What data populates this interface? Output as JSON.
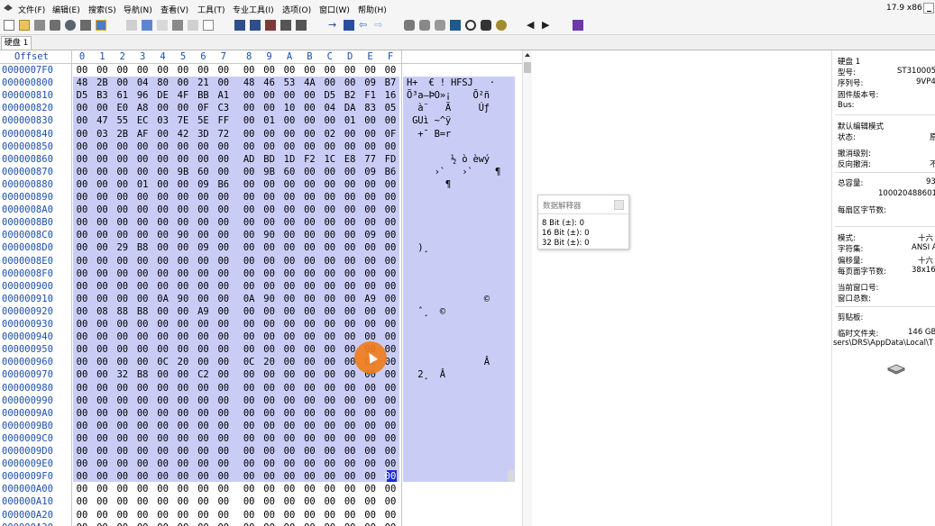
{
  "menubar": {
    "items": [
      "文件(F)",
      "编辑(E)",
      "搜索(S)",
      "导航(N)",
      "查看(V)",
      "工具(T)",
      "专业工具(I)",
      "选项(O)",
      "窗口(W)",
      "帮助(H)"
    ],
    "version": "17.9 x86"
  },
  "tabs": [
    "硬盘 1"
  ],
  "hex": {
    "offset_label": "Offset",
    "columns": [
      "0",
      "1",
      "2",
      "3",
      "4",
      "5",
      "6",
      "7",
      "8",
      "9",
      "A",
      "B",
      "C",
      "D",
      "E",
      "F"
    ],
    "rows": [
      {
        "offset": "0000007F0",
        "bytes": [
          "00",
          "00",
          "00",
          "00",
          "00",
          "00",
          "00",
          "00",
          "00",
          "00",
          "00",
          "00",
          "00",
          "00",
          "00",
          "00"
        ],
        "ascii": ""
      },
      {
        "offset": "000000800",
        "bytes": [
          "48",
          "2B",
          "00",
          "04",
          "80",
          "00",
          "21",
          "00",
          "48",
          "46",
          "53",
          "4A",
          "00",
          "00",
          "09",
          "B7"
        ],
        "ascii": "H+  € ! HFSJ   ·"
      },
      {
        "offset": "000000810",
        "bytes": [
          "D5",
          "B3",
          "61",
          "96",
          "DE",
          "4F",
          "BB",
          "A1",
          "00",
          "00",
          "00",
          "00",
          "D5",
          "B2",
          "F1",
          "16"
        ],
        "ascii": "Õ³a–ÞO»¡    Õ²ñ"
      },
      {
        "offset": "000000820",
        "bytes": [
          "00",
          "00",
          "E0",
          "A8",
          "00",
          "00",
          "0F",
          "C3",
          "00",
          "00",
          "10",
          "00",
          "04",
          "DA",
          "83",
          "05"
        ],
        "ascii": "  à¨   Ã     Úƒ"
      },
      {
        "offset": "000000830",
        "bytes": [
          "00",
          "47",
          "55",
          "EC",
          "03",
          "7E",
          "5E",
          "FF",
          "00",
          "01",
          "00",
          "00",
          "00",
          "01",
          "00",
          "00"
        ],
        "ascii": " GUì ~^ÿ"
      },
      {
        "offset": "000000840",
        "bytes": [
          "00",
          "03",
          "2B",
          "AF",
          "00",
          "42",
          "3D",
          "72",
          "00",
          "00",
          "00",
          "00",
          "02",
          "00",
          "00",
          "0F"
        ],
        "ascii": "  +¯ B=r"
      },
      {
        "offset": "000000850",
        "bytes": [
          "00",
          "00",
          "00",
          "00",
          "00",
          "00",
          "00",
          "00",
          "00",
          "00",
          "00",
          "00",
          "00",
          "00",
          "00",
          "00"
        ],
        "ascii": ""
      },
      {
        "offset": "000000860",
        "bytes": [
          "00",
          "00",
          "00",
          "00",
          "00",
          "00",
          "00",
          "00",
          "AD",
          "BD",
          "1D",
          "F2",
          "1C",
          "E8",
          "77",
          "FD"
        ],
        "ascii": "        ­½ ò èwý"
      },
      {
        "offset": "000000870",
        "bytes": [
          "00",
          "00",
          "00",
          "00",
          "00",
          "9B",
          "60",
          "00",
          "00",
          "9B",
          "60",
          "00",
          "00",
          "00",
          "09",
          "B6"
        ],
        "ascii": "     ›`   ›`    ¶"
      },
      {
        "offset": "000000880",
        "bytes": [
          "00",
          "00",
          "00",
          "01",
          "00",
          "00",
          "09",
          "B6",
          "00",
          "00",
          "00",
          "00",
          "00",
          "00",
          "00",
          "00"
        ],
        "ascii": "       ¶"
      },
      {
        "offset": "000000890",
        "bytes": [
          "00",
          "00",
          "00",
          "00",
          "00",
          "00",
          "00",
          "00",
          "00",
          "00",
          "00",
          "00",
          "00",
          "00",
          "00",
          "00"
        ],
        "ascii": ""
      },
      {
        "offset": "0000008A0",
        "bytes": [
          "00",
          "00",
          "00",
          "00",
          "00",
          "00",
          "00",
          "00",
          "00",
          "00",
          "00",
          "00",
          "00",
          "00",
          "00",
          "00"
        ],
        "ascii": ""
      },
      {
        "offset": "0000008B0",
        "bytes": [
          "00",
          "00",
          "00",
          "00",
          "00",
          "00",
          "00",
          "00",
          "00",
          "00",
          "00",
          "00",
          "00",
          "00",
          "00",
          "00"
        ],
        "ascii": ""
      },
      {
        "offset": "0000008C0",
        "bytes": [
          "00",
          "00",
          "00",
          "00",
          "00",
          "90",
          "00",
          "00",
          "00",
          "90",
          "00",
          "00",
          "00",
          "00",
          "09",
          "00"
        ],
        "ascii": ""
      },
      {
        "offset": "0000008D0",
        "bytes": [
          "00",
          "00",
          "29",
          "B8",
          "00",
          "00",
          "09",
          "00",
          "00",
          "00",
          "00",
          "00",
          "00",
          "00",
          "00",
          "00"
        ],
        "ascii": "  )¸"
      },
      {
        "offset": "0000008E0",
        "bytes": [
          "00",
          "00",
          "00",
          "00",
          "00",
          "00",
          "00",
          "00",
          "00",
          "00",
          "00",
          "00",
          "00",
          "00",
          "00",
          "00"
        ],
        "ascii": ""
      },
      {
        "offset": "0000008F0",
        "bytes": [
          "00",
          "00",
          "00",
          "00",
          "00",
          "00",
          "00",
          "00",
          "00",
          "00",
          "00",
          "00",
          "00",
          "00",
          "00",
          "00"
        ],
        "ascii": ""
      },
      {
        "offset": "000000900",
        "bytes": [
          "00",
          "00",
          "00",
          "00",
          "00",
          "00",
          "00",
          "00",
          "00",
          "00",
          "00",
          "00",
          "00",
          "00",
          "00",
          "00"
        ],
        "ascii": ""
      },
      {
        "offset": "000000910",
        "bytes": [
          "00",
          "00",
          "00",
          "00",
          "0A",
          "90",
          "00",
          "00",
          "0A",
          "90",
          "00",
          "00",
          "00",
          "00",
          "A9",
          "00"
        ],
        "ascii": "              ©"
      },
      {
        "offset": "000000920",
        "bytes": [
          "00",
          "08",
          "88",
          "B8",
          "00",
          "00",
          "A9",
          "00",
          "00",
          "00",
          "00",
          "00",
          "00",
          "00",
          "00",
          "00"
        ],
        "ascii": "  ˆ¸  ©"
      },
      {
        "offset": "000000930",
        "bytes": [
          "00",
          "00",
          "00",
          "00",
          "00",
          "00",
          "00",
          "00",
          "00",
          "00",
          "00",
          "00",
          "00",
          "00",
          "00",
          "00"
        ],
        "ascii": ""
      },
      {
        "offset": "000000940",
        "bytes": [
          "00",
          "00",
          "00",
          "00",
          "00",
          "00",
          "00",
          "00",
          "00",
          "00",
          "00",
          "00",
          "00",
          "00",
          "00",
          "00"
        ],
        "ascii": ""
      },
      {
        "offset": "000000950",
        "bytes": [
          "00",
          "00",
          "00",
          "00",
          "00",
          "00",
          "00",
          "00",
          "00",
          "00",
          "00",
          "00",
          "00",
          "00",
          "00",
          "00"
        ],
        "ascii": ""
      },
      {
        "offset": "000000960",
        "bytes": [
          "00",
          "00",
          "00",
          "00",
          "0C",
          "20",
          "00",
          "00",
          "0C",
          "20",
          "00",
          "00",
          "00",
          "00",
          "C2",
          "00"
        ],
        "ascii": "              Â"
      },
      {
        "offset": "000000970",
        "bytes": [
          "00",
          "00",
          "32",
          "B8",
          "00",
          "00",
          "C2",
          "00",
          "00",
          "00",
          "00",
          "00",
          "00",
          "00",
          "00",
          "00"
        ],
        "ascii": "  2¸  Â"
      },
      {
        "offset": "000000980",
        "bytes": [
          "00",
          "00",
          "00",
          "00",
          "00",
          "00",
          "00",
          "00",
          "00",
          "00",
          "00",
          "00",
          "00",
          "00",
          "00",
          "00"
        ],
        "ascii": ""
      },
      {
        "offset": "000000990",
        "bytes": [
          "00",
          "00",
          "00",
          "00",
          "00",
          "00",
          "00",
          "00",
          "00",
          "00",
          "00",
          "00",
          "00",
          "00",
          "00",
          "00"
        ],
        "ascii": ""
      },
      {
        "offset": "0000009A0",
        "bytes": [
          "00",
          "00",
          "00",
          "00",
          "00",
          "00",
          "00",
          "00",
          "00",
          "00",
          "00",
          "00",
          "00",
          "00",
          "00",
          "00"
        ],
        "ascii": ""
      },
      {
        "offset": "0000009B0",
        "bytes": [
          "00",
          "00",
          "00",
          "00",
          "00",
          "00",
          "00",
          "00",
          "00",
          "00",
          "00",
          "00",
          "00",
          "00",
          "00",
          "00"
        ],
        "ascii": ""
      },
      {
        "offset": "0000009C0",
        "bytes": [
          "00",
          "00",
          "00",
          "00",
          "00",
          "00",
          "00",
          "00",
          "00",
          "00",
          "00",
          "00",
          "00",
          "00",
          "00",
          "00"
        ],
        "ascii": ""
      },
      {
        "offset": "0000009D0",
        "bytes": [
          "00",
          "00",
          "00",
          "00",
          "00",
          "00",
          "00",
          "00",
          "00",
          "00",
          "00",
          "00",
          "00",
          "00",
          "00",
          "00"
        ],
        "ascii": ""
      },
      {
        "offset": "0000009E0",
        "bytes": [
          "00",
          "00",
          "00",
          "00",
          "00",
          "00",
          "00",
          "00",
          "00",
          "00",
          "00",
          "00",
          "00",
          "00",
          "00",
          "00"
        ],
        "ascii": ""
      },
      {
        "offset": "0000009F0",
        "bytes": [
          "00",
          "00",
          "00",
          "00",
          "00",
          "00",
          "00",
          "00",
          "00",
          "00",
          "00",
          "00",
          "00",
          "00",
          "00",
          "00"
        ],
        "ascii": ""
      },
      {
        "offset": "000000A00",
        "bytes": [
          "00",
          "00",
          "00",
          "00",
          "00",
          "00",
          "00",
          "00",
          "00",
          "00",
          "00",
          "00",
          "00",
          "00",
          "00",
          "00"
        ],
        "ascii": ""
      },
      {
        "offset": "000000A10",
        "bytes": [
          "00",
          "00",
          "00",
          "00",
          "00",
          "00",
          "00",
          "00",
          "00",
          "00",
          "00",
          "00",
          "00",
          "00",
          "00",
          "00"
        ],
        "ascii": ""
      },
      {
        "offset": "000000A20",
        "bytes": [
          "00",
          "00",
          "00",
          "00",
          "00",
          "00",
          "00",
          "00",
          "00",
          "00",
          "00",
          "00",
          "00",
          "00",
          "00",
          "00"
        ],
        "ascii": ""
      },
      {
        "offset": "000000A30",
        "bytes": [
          "00",
          "00",
          "00",
          "00",
          "00",
          "00",
          "00",
          "00",
          "00",
          "00",
          "00",
          "00",
          "00",
          "00",
          "00",
          "00"
        ],
        "ascii": ""
      }
    ]
  },
  "data_interpreter": {
    "title": "数据解释器",
    "rows": [
      "8 Bit (±): 0",
      "16 Bit (±): 0",
      "32 Bit (±): 0"
    ]
  },
  "info_panel": {
    "disk_name": "硬盘 1",
    "model_label": "型号:",
    "model_value": "ST310005",
    "serial_label": "序列号:",
    "serial_value": "9VP4",
    "firmware_label": "固件版本号:",
    "bus_label": "Bus:",
    "edit_mode_label": "默认编辑模式",
    "state_label": "状态:",
    "state_value": "原",
    "undo_level_label": "撤消级别:",
    "reverse_undo_label": "反向撤消:",
    "reverse_undo_value": "不",
    "total_capacity_label": "总容量:",
    "total_capacity_value": "93",
    "total_bytes_value": "1000204886016",
    "bytes_per_sector_label": "每扇区字节数:",
    "mode_label": "模式:",
    "mode_value": "十六",
    "charset_label": "字符集:",
    "charset_value": "ANSI A",
    "offset_label": "偏移量:",
    "offset_value": "十六",
    "bytes_per_page_label": "每页面字节数:",
    "bytes_per_page_value": "38x16",
    "current_window_label": "当前窗口号:",
    "window_total_label": "窗口总数:",
    "clipboard_label": "剪贴板:",
    "temp_folder_label": "临时文件夹:",
    "temp_folder_value": "146 GB",
    "temp_path": "sers\\DRS\\AppData\\Local\\T"
  },
  "colors": {
    "selection": "#c9cdf6",
    "offset_blue": "#1a4fae",
    "cursor_dot": "#ef7d1c"
  }
}
